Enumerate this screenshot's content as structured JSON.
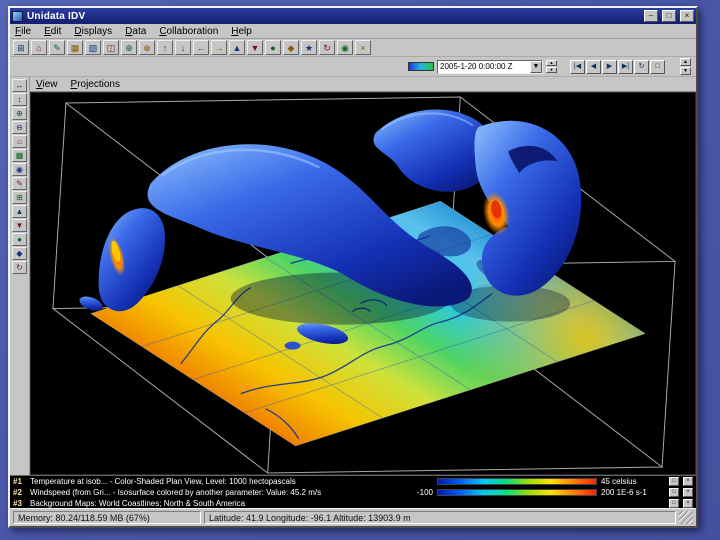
{
  "colors": {
    "titlebar": "#1f2d8c",
    "desktop": "#4a58aa",
    "canvas_bg": "#000000",
    "isosurface_blue": "#2b62e0",
    "map_warm": "#f6c400",
    "map_cold": "#3aa8e0"
  },
  "window": {
    "title": "Unidata IDV",
    "buttons": [
      "–",
      "□",
      "×"
    ]
  },
  "menubar": {
    "items": [
      "File",
      "Edit",
      "Displays",
      "Data",
      "Collaboration",
      "Help"
    ]
  },
  "toolbar": {
    "icons": [
      "⊞",
      "⌂",
      "✎",
      "▦",
      "▧",
      "◫",
      "⊕",
      "⊗",
      "↑",
      "↓",
      "←",
      "→",
      "▲",
      "▼",
      "●",
      "◆",
      "★",
      "↻",
      "◉",
      "×"
    ]
  },
  "timebar": {
    "time_value": "2005-1-20 0:00:00 Z",
    "dropdown_arrow": "▼",
    "spinner": [
      "▲",
      "▼"
    ],
    "play_buttons": [
      "|◀",
      "◀",
      "▶",
      "▶|",
      "↻",
      "□"
    ],
    "corner_buttons": [
      "▲",
      "▼"
    ]
  },
  "view_menubar": {
    "items": [
      "View",
      "Projections"
    ]
  },
  "left_toolbar": {
    "icons": [
      "↔",
      "↕",
      "⊕",
      "⊖",
      "⌂",
      "▦",
      "◉",
      "✎",
      "⊞",
      "▲",
      "▼",
      "●",
      "◆",
      "↻"
    ]
  },
  "legend": {
    "row_buttons": [
      "□",
      "×"
    ],
    "rows": [
      {
        "id": "#1",
        "label": "Temperature at isob... - Color-Shaded Plan View, Level: 1000 hectopascals",
        "min": "",
        "max": "45 celsius"
      },
      {
        "id": "#2",
        "label": "Windspeed (from Gri... - Isosurface colored by another parameter: Value: 45.2 m/s",
        "min": "-100",
        "max": "200 1E-6 s-1"
      },
      {
        "id": "#3",
        "label": "Background Maps: World Coastlines; North & South America",
        "min": "",
        "max": ""
      }
    ]
  },
  "statusbar": {
    "memory": "Memory: 80.24/118.59 MB (67%)",
    "position": "Latitude: 41.9 Longitude: -96.1 Altitude: 13903.9 m"
  }
}
